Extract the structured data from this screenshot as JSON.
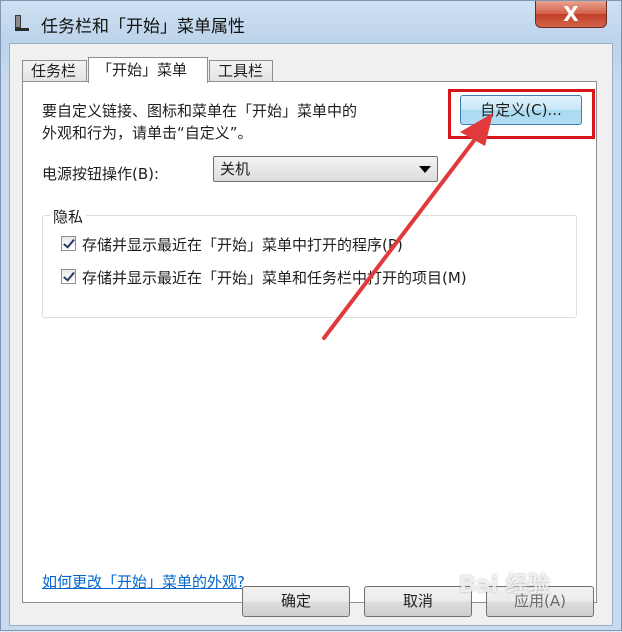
{
  "window": {
    "title": "任务栏和「开始」菜单属性",
    "close_symbol": "X"
  },
  "tabs": [
    {
      "label": "任务栏",
      "active": false
    },
    {
      "label": "「开始」菜单",
      "active": true
    },
    {
      "label": "工具栏",
      "active": false
    }
  ],
  "start_menu": {
    "description_line1": "要自定义链接、图标和菜单在「开始」菜单中的",
    "description_line2": "外观和行为，请单击“自定义”。",
    "customize_label": "自定义(C)...",
    "power_label": "电源按钮操作(B):",
    "power_value": "关机",
    "privacy": {
      "legend": "隐私",
      "items": [
        {
          "label": "存储并显示最近在「开始」菜单中打开的程序(P)",
          "checked": true
        },
        {
          "label": "存储并显示最近在「开始」菜单和任务栏中打开的项目(M)",
          "checked": true
        }
      ]
    },
    "help_link": "如何更改「开始」菜单的外观?"
  },
  "buttons": {
    "ok": "确定",
    "cancel": "取消",
    "apply": "应用(A)"
  },
  "watermark": "Bai 经验",
  "colors": {
    "highlight": "#d7161a",
    "arrow": "#e03a3c",
    "link": "#0066cc"
  },
  "icons": [
    "taskbar-properties-icon",
    "close-icon",
    "chevron-down-icon",
    "checkmark-icon",
    "annotation-arrow"
  ]
}
